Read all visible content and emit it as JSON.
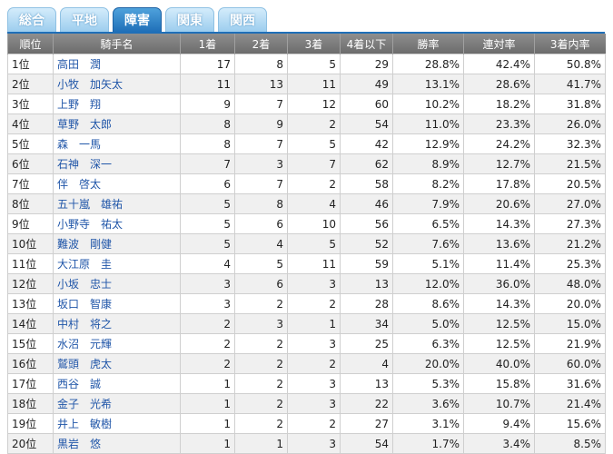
{
  "tabs": [
    {
      "label": "総合",
      "active": false
    },
    {
      "label": "平地",
      "active": false
    },
    {
      "label": "障害",
      "active": true
    },
    {
      "label": "関東",
      "active": false
    },
    {
      "label": "関西",
      "active": false
    }
  ],
  "table": {
    "headers": [
      "順位",
      "騎手名",
      "1着",
      "2着",
      "3着",
      "4着以下",
      "勝率",
      "連対率",
      "3着内率"
    ],
    "rows": [
      [
        "1位",
        "高田　潤",
        "17",
        "8",
        "5",
        "29",
        "28.8%",
        "42.4%",
        "50.8%"
      ],
      [
        "2位",
        "小牧　加矢太",
        "11",
        "13",
        "11",
        "49",
        "13.1%",
        "28.6%",
        "41.7%"
      ],
      [
        "3位",
        "上野　翔",
        "9",
        "7",
        "12",
        "60",
        "10.2%",
        "18.2%",
        "31.8%"
      ],
      [
        "4位",
        "草野　太郎",
        "8",
        "9",
        "2",
        "54",
        "11.0%",
        "23.3%",
        "26.0%"
      ],
      [
        "5位",
        "森　一馬",
        "8",
        "7",
        "5",
        "42",
        "12.9%",
        "24.2%",
        "32.3%"
      ],
      [
        "6位",
        "石神　深一",
        "7",
        "3",
        "7",
        "62",
        "8.9%",
        "12.7%",
        "21.5%"
      ],
      [
        "7位",
        "伴　啓太",
        "6",
        "7",
        "2",
        "58",
        "8.2%",
        "17.8%",
        "20.5%"
      ],
      [
        "8位",
        "五十嵐　雄祐",
        "5",
        "8",
        "4",
        "46",
        "7.9%",
        "20.6%",
        "27.0%"
      ],
      [
        "9位",
        "小野寺　祐太",
        "5",
        "6",
        "10",
        "56",
        "6.5%",
        "14.3%",
        "27.3%"
      ],
      [
        "10位",
        "難波　剛健",
        "5",
        "4",
        "5",
        "52",
        "7.6%",
        "13.6%",
        "21.2%"
      ],
      [
        "11位",
        "大江原　圭",
        "4",
        "5",
        "11",
        "59",
        "5.1%",
        "11.4%",
        "25.3%"
      ],
      [
        "12位",
        "小坂　忠士",
        "3",
        "6",
        "3",
        "13",
        "12.0%",
        "36.0%",
        "48.0%"
      ],
      [
        "13位",
        "坂口　智康",
        "3",
        "2",
        "2",
        "28",
        "8.6%",
        "14.3%",
        "20.0%"
      ],
      [
        "14位",
        "中村　将之",
        "2",
        "3",
        "1",
        "34",
        "5.0%",
        "12.5%",
        "15.0%"
      ],
      [
        "15位",
        "水沼　元輝",
        "2",
        "2",
        "3",
        "25",
        "6.3%",
        "12.5%",
        "21.9%"
      ],
      [
        "16位",
        "鷲頭　虎太",
        "2",
        "2",
        "2",
        "4",
        "20.0%",
        "40.0%",
        "60.0%"
      ],
      [
        "17位",
        "西谷　誠",
        "1",
        "2",
        "3",
        "13",
        "5.3%",
        "15.8%",
        "31.6%"
      ],
      [
        "18位",
        "金子　光希",
        "1",
        "2",
        "3",
        "22",
        "3.6%",
        "10.7%",
        "21.4%"
      ],
      [
        "19位",
        "井上　敏樹",
        "1",
        "2",
        "2",
        "27",
        "3.1%",
        "9.4%",
        "15.6%"
      ],
      [
        "20位",
        "黒岩　悠",
        "1",
        "1",
        "3",
        "54",
        "1.7%",
        "3.4%",
        "8.5%"
      ]
    ]
  }
}
